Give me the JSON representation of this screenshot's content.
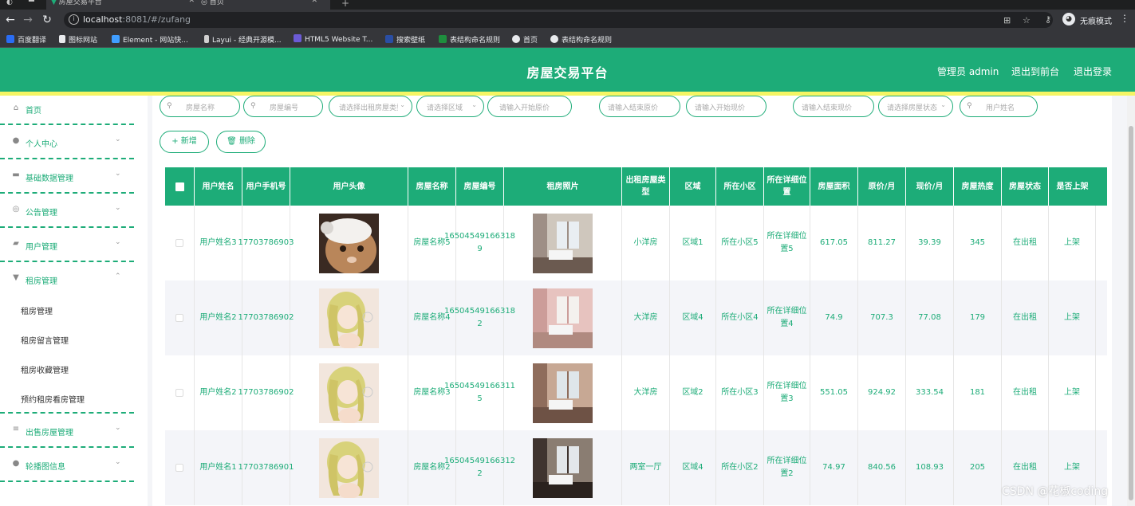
{
  "browser": {
    "tabs": [
      {
        "title": "房屋交易平台",
        "active": true
      },
      {
        "title": "首页",
        "active": false
      }
    ],
    "url_host": "localhost",
    "url_path": ":8081/#/zufang",
    "profile_label": "无痕模式",
    "bookmarks": [
      {
        "label": "百度翻译",
        "icon": "baidu-translate-icon",
        "color": "#2a6df4"
      },
      {
        "label": "图标网站",
        "icon": "flag-icon",
        "color": "#e8eaed"
      },
      {
        "label": "Element - 网站快...",
        "icon": "element-icon",
        "color": "#409eff"
      },
      {
        "label": "Layui - 经典开源模...",
        "icon": "layui-icon",
        "color": "#d0d0d0"
      },
      {
        "label": "HTML5 Website T...",
        "icon": "html5-icon",
        "color": "#6b5bd6"
      },
      {
        "label": "搜索壁纸",
        "icon": "wallpaper-icon",
        "color": "#2a4ea4"
      },
      {
        "label": "表结构命名规则",
        "icon": "sheet-icon",
        "color": "#1e8e3e"
      },
      {
        "label": "首页",
        "icon": "globe-icon",
        "color": "#e8eaed"
      },
      {
        "label": "表结构命名规则",
        "icon": "globe-icon",
        "color": "#e8eaed"
      }
    ]
  },
  "header": {
    "title": "房屋交易平台",
    "admin_label": "管理员 admin",
    "front_label": "退出到前台",
    "logout_label": "退出登录",
    "color": "#1dac78",
    "strip_color": "#f5f564"
  },
  "sidebar": {
    "items": [
      {
        "label": "首页",
        "icon": "home-icon"
      },
      {
        "label": "个人中心",
        "icon": "user-icon"
      },
      {
        "label": "基础数据管理",
        "icon": "data-icon"
      },
      {
        "label": "公告管理",
        "icon": "notice-icon"
      },
      {
        "label": "用户管理",
        "icon": "users-icon"
      },
      {
        "label": "租房管理",
        "icon": "rent-icon"
      },
      {
        "label": "出售房屋管理",
        "icon": "list-icon"
      },
      {
        "label": "轮播图信息",
        "icon": "carousel-icon"
      }
    ],
    "subitems": [
      "租房管理",
      "租房留言管理",
      "租房收藏管理",
      "预约租房看房管理"
    ]
  },
  "search": {
    "fields": [
      {
        "placeholder": "房屋名称",
        "icon": "search-icon",
        "caret": false
      },
      {
        "placeholder": "房屋编号",
        "icon": "search-icon",
        "caret": false
      },
      {
        "placeholder": "请选择出租房屋类型",
        "icon": "",
        "caret": true
      },
      {
        "placeholder": "请选择区域",
        "icon": "",
        "caret": true
      },
      {
        "placeholder": "请输入开始原价",
        "icon": "",
        "caret": false
      },
      {
        "placeholder": "请输入结束原价",
        "icon": "",
        "caret": false
      },
      {
        "placeholder": "请输入开始现价",
        "icon": "",
        "caret": false
      },
      {
        "placeholder": "请输入结束现价",
        "icon": "",
        "caret": false
      },
      {
        "placeholder": "请选择房屋状态",
        "icon": "",
        "caret": true
      },
      {
        "placeholder": "用户姓名",
        "icon": "search-icon",
        "caret": false
      }
    ],
    "add_label": "+ 新增",
    "delete_label": "删除"
  },
  "table": {
    "columns": [
      "",
      "用户姓名",
      "用户手机号",
      "用户头像",
      "房屋名称",
      "房屋编号",
      "租房照片",
      "出租房屋类型",
      "区域",
      "所在小区",
      "所在详细位置",
      "房屋面积",
      "原价/月",
      "现价/月",
      "房屋热度",
      "房屋状态",
      "是否上架"
    ],
    "rows": [
      {
        "user_name": "用户姓名3",
        "phone": "17703786903",
        "avatar": "cat-avatar",
        "house_name": "房屋名称5",
        "house_no": "16504549166318 9",
        "photo": "room-photo-1",
        "type": "小洋房",
        "region": "区域1",
        "community": "所在小区5",
        "address": "所在详细位置5",
        "area": "617.05",
        "orig_price": "811.27",
        "cur_price": "39.39",
        "heat": "345",
        "status": "在出租",
        "shelf": "上架"
      },
      {
        "user_name": "用户姓名2",
        "phone": "17703786902",
        "avatar": "anime-avatar",
        "house_name": "房屋名称4",
        "house_no": "16504549166318 2",
        "photo": "room-photo-2",
        "type": "大洋房",
        "region": "区域4",
        "community": "所在小区4",
        "address": "所在详细位置4",
        "area": "74.9",
        "orig_price": "707.3",
        "cur_price": "77.08",
        "heat": "179",
        "status": "在出租",
        "shelf": "上架"
      },
      {
        "user_name": "用户姓名2",
        "phone": "17703786902",
        "avatar": "anime-avatar",
        "house_name": "房屋名称3",
        "house_no": "16504549166311 5",
        "photo": "room-photo-3",
        "type": "大洋房",
        "region": "区域2",
        "community": "所在小区3",
        "address": "所在详细位置3",
        "area": "551.05",
        "orig_price": "924.92",
        "cur_price": "333.54",
        "heat": "181",
        "status": "在出租",
        "shelf": "上架"
      },
      {
        "user_name": "用户姓名1",
        "phone": "17703786901",
        "avatar": "anime-avatar",
        "house_name": "房屋名称2",
        "house_no": "16504549166312 2",
        "photo": "room-photo-4",
        "type": "两室一厅",
        "region": "区域4",
        "community": "所在小区2",
        "address": "所在详细位置2",
        "area": "74.97",
        "orig_price": "840.56",
        "cur_price": "108.93",
        "heat": "205",
        "status": "在出租",
        "shelf": "上架"
      }
    ]
  },
  "watermark": "CSDN @花椒coding"
}
